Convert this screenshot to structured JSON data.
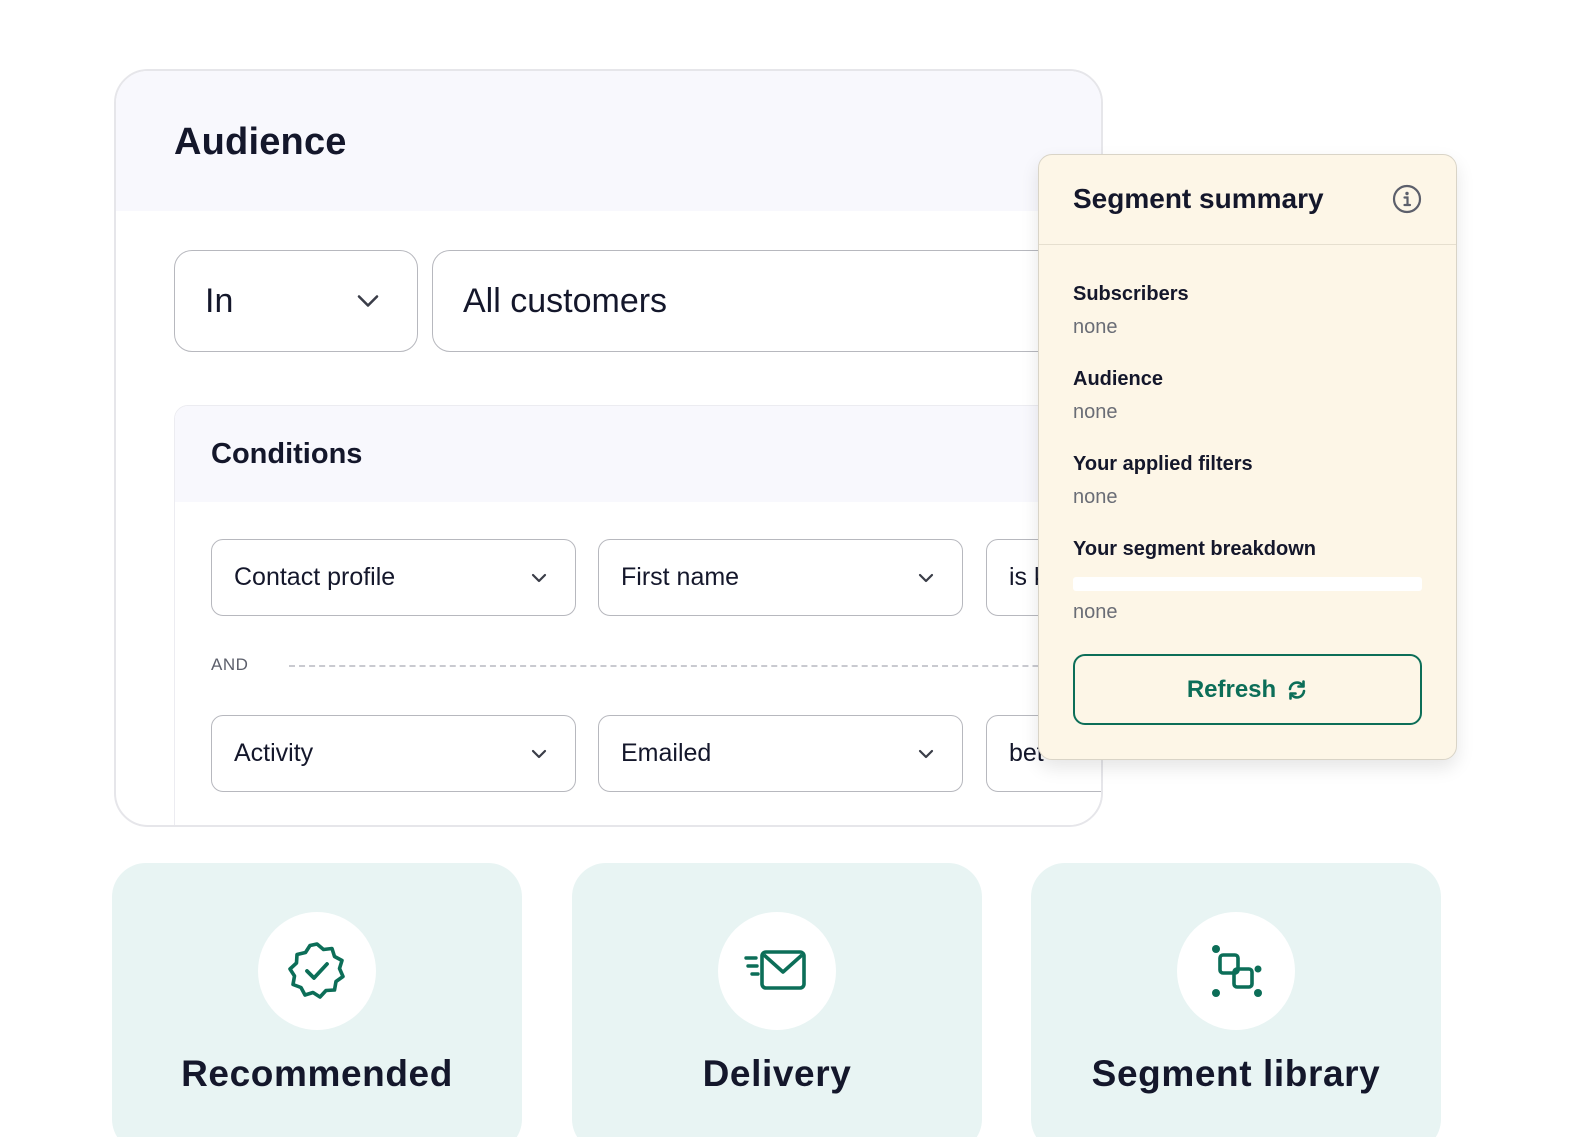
{
  "audience": {
    "title": "Audience",
    "in_select": {
      "value": "In"
    },
    "scope_select": {
      "value": "All customers"
    },
    "conditions": {
      "title": "Conditions",
      "rows": [
        {
          "field": "Contact profile",
          "attribute": "First name",
          "operator": "is k"
        },
        {
          "field": "Activity",
          "attribute": "Emailed",
          "operator": "bet"
        }
      ],
      "joiner": "AND"
    }
  },
  "summary": {
    "title": "Segment summary",
    "subscribers": {
      "label": "Subscribers",
      "value": "none"
    },
    "audience": {
      "label": "Audience",
      "value": "none"
    },
    "filters": {
      "label": "Your applied filters",
      "value": "none"
    },
    "breakdown": {
      "label": "Your segment breakdown",
      "value": "none"
    },
    "refresh_label": "Refresh"
  },
  "features": [
    {
      "title": "Recommended",
      "icon": "verified-badge-icon"
    },
    {
      "title": "Delivery",
      "icon": "fast-mail-icon"
    },
    {
      "title": "Segment library",
      "icon": "segment-nodes-icon"
    }
  ],
  "colors": {
    "accent": "#0c6e58",
    "summary_bg": "#fdf6e7",
    "feature_bg": "#e8f4f3",
    "header_bg": "#f8f8fd",
    "text": "#14172b"
  }
}
